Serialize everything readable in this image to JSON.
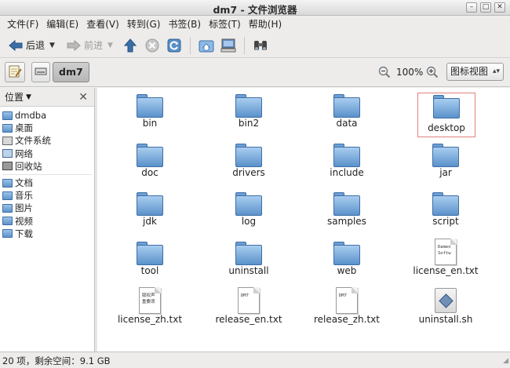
{
  "window": {
    "title": "dm7 - 文件浏览器"
  },
  "menu": [
    "文件(F)",
    "编辑(E)",
    "查看(V)",
    "转到(G)",
    "书签(B)",
    "标签(T)",
    "帮助(H)"
  ],
  "toolbar": {
    "back_label": "后退",
    "forward_label": "前进"
  },
  "location": {
    "current_folder": "dm7",
    "zoom": "100%",
    "view_mode": "图标视图"
  },
  "sidebar": {
    "header": "位置",
    "places": [
      {
        "label": "dmdba",
        "icon": "home-folder-icon"
      },
      {
        "label": "桌面",
        "icon": "desktop-folder-icon"
      },
      {
        "label": "文件系统",
        "icon": "drive-icon"
      },
      {
        "label": "网络",
        "icon": "network-icon"
      },
      {
        "label": "回收站",
        "icon": "trash-icon"
      }
    ],
    "bookmarks": [
      {
        "label": "文档",
        "icon": "folder-icon"
      },
      {
        "label": "音乐",
        "icon": "folder-icon"
      },
      {
        "label": "图片",
        "icon": "folder-icon"
      },
      {
        "label": "视频",
        "icon": "folder-icon"
      },
      {
        "label": "下载",
        "icon": "folder-icon"
      }
    ]
  },
  "files": [
    {
      "name": "bin",
      "type": "folder"
    },
    {
      "name": "bin2",
      "type": "folder"
    },
    {
      "name": "data",
      "type": "folder"
    },
    {
      "name": "desktop",
      "type": "folder",
      "selected": true
    },
    {
      "name": "doc",
      "type": "folder"
    },
    {
      "name": "drivers",
      "type": "folder"
    },
    {
      "name": "include",
      "type": "folder"
    },
    {
      "name": "jar",
      "type": "folder"
    },
    {
      "name": "jdk",
      "type": "folder"
    },
    {
      "name": "log",
      "type": "folder"
    },
    {
      "name": "samples",
      "type": "folder"
    },
    {
      "name": "script",
      "type": "folder"
    },
    {
      "name": "tool",
      "type": "folder"
    },
    {
      "name": "uninstall",
      "type": "folder"
    },
    {
      "name": "web",
      "type": "folder"
    },
    {
      "name": "license_en.txt",
      "type": "text",
      "preview": "Damen\nSoftw"
    },
    {
      "name": "license_zh.txt",
      "type": "text",
      "preview": "版权声\n重要须"
    },
    {
      "name": "release_en.txt",
      "type": "text",
      "preview": "DM7"
    },
    {
      "name": "release_zh.txt",
      "type": "text",
      "preview": "DM7"
    },
    {
      "name": "uninstall.sh",
      "type": "script"
    }
  ],
  "status": {
    "text": "20 项，剩余空间：9.1 GB"
  }
}
